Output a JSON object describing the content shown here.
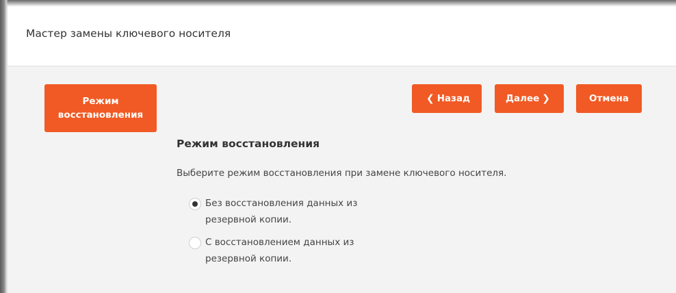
{
  "dialog": {
    "title": "Мастер замены ключевого носителя"
  },
  "steps": {
    "current_line1": "Режим",
    "current_line2": "восстановления"
  },
  "nav": {
    "back_icon": "chevron-left-icon",
    "back_label": "Назад",
    "next_label": "Далее",
    "next_icon": "chevron-right-icon",
    "cancel_label": "Отмена"
  },
  "content": {
    "section_title": "Режим восстановления",
    "description": "Выберите режим восстановления при замене ключевого носителя.",
    "options": [
      {
        "label": "Без восстановления данных из резервной копии.",
        "checked": true
      },
      {
        "label": "С восстановлением данных из резервной копии.",
        "checked": false
      }
    ]
  },
  "colors": {
    "accent": "#f15a24",
    "background": "#f3f3f3",
    "header_bg": "#ffffff",
    "text": "#333333"
  }
}
